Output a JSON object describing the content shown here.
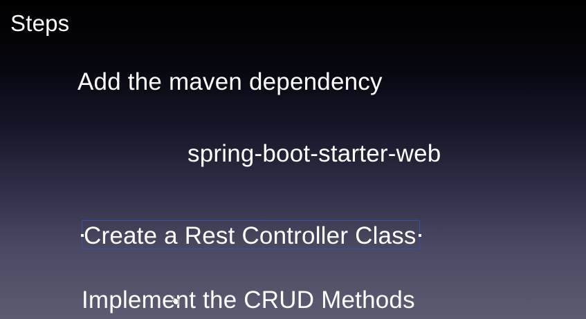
{
  "slide": {
    "title": "Steps",
    "steps": [
      {
        "label": "Add the maven dependency"
      },
      {
        "label": "spring-boot-starter-web"
      },
      {
        "label": "Create a Rest Controller Class"
      },
      {
        "label": "Implement the CRUD Methods"
      }
    ]
  },
  "colors": {
    "text": "#ffffff",
    "selection_border": "#3a4fa8",
    "background_top": "#000000",
    "background_bottom": "#5c5b72"
  },
  "icons": {
    "cursor": "hand-pointer-icon"
  }
}
